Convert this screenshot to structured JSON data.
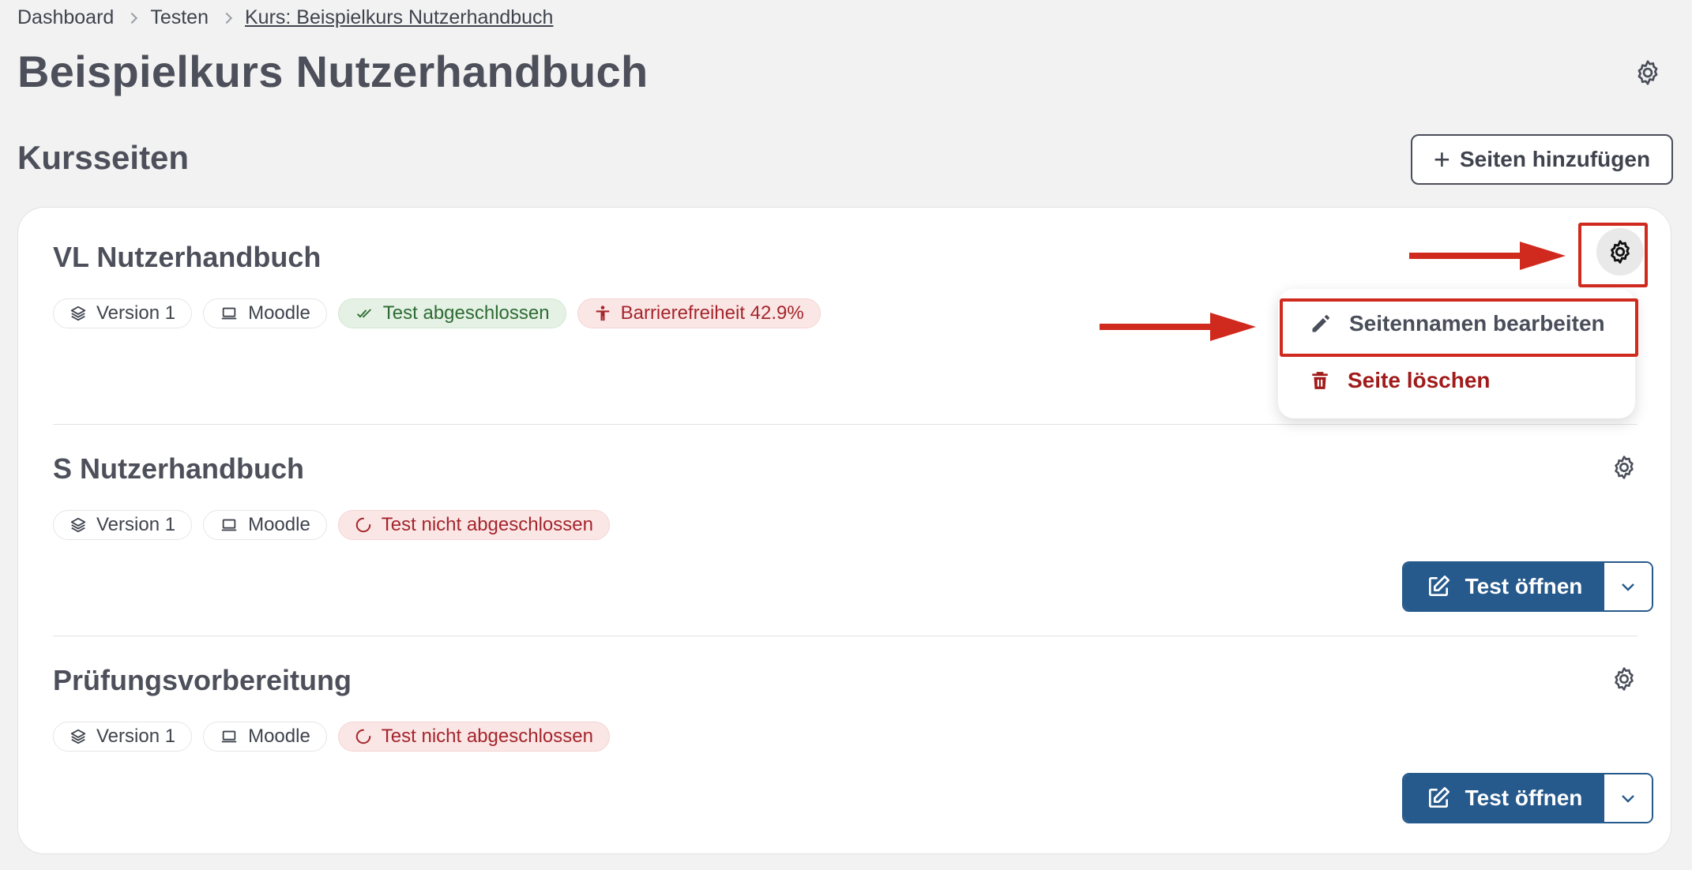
{
  "breadcrumb": [
    "Dashboard",
    "Testen",
    "Kurs: Beispielkurs Nutzerhandbuch"
  ],
  "page_title": "Beispielkurs Nutzerhandbuch",
  "section_title": "Kursseiten",
  "add_button": {
    "plus": "+",
    "label": "Seiten hinzufügen"
  },
  "pages": [
    {
      "title": "VL Nutzerhandbuch",
      "chips": [
        {
          "icon": "layers-icon",
          "label": "Version 1"
        },
        {
          "icon": "laptop-icon",
          "label": "Moodle"
        },
        {
          "icon": "double-check-icon",
          "label": "Test abgeschlossen",
          "status": "success"
        },
        {
          "icon": "accessibility-icon",
          "label": "Barrierefreiheit 42.9%",
          "status": "danger"
        }
      ]
    },
    {
      "title": "S Nutzerhandbuch",
      "chips": [
        {
          "icon": "layers-icon",
          "label": "Version 1"
        },
        {
          "icon": "laptop-icon",
          "label": "Moodle"
        },
        {
          "icon": "spinner-icon",
          "label": "Test nicht abgeschlossen",
          "status": "danger"
        }
      ],
      "action_label": "Test öffnen"
    },
    {
      "title": "Prüfungsvorbereitung",
      "chips": [
        {
          "icon": "layers-icon",
          "label": "Version 1"
        },
        {
          "icon": "laptop-icon",
          "label": "Moodle"
        },
        {
          "icon": "spinner-icon",
          "label": "Test nicht abgeschlossen",
          "status": "danger"
        }
      ],
      "action_label": "Test öffnen"
    }
  ],
  "context_menu": {
    "edit_label": "Seitennamen bearbeiten",
    "delete_label": "Seite löschen"
  },
  "colors": {
    "primary": "#275a8c",
    "danger": "#a11b1b",
    "success": "#2e6b34",
    "annotation": "#d02a1f",
    "background": "#f2f2f2"
  }
}
